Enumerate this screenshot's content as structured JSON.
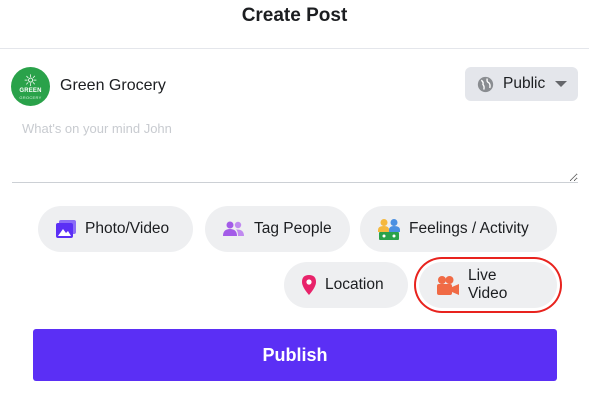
{
  "dialog": {
    "title": "Create Post"
  },
  "page": {
    "name": "Green Grocery",
    "logo_word": "GREEN",
    "logo_sub": "GROCERY",
    "logo_color": "#2aa24a"
  },
  "privacy": {
    "label": "Public",
    "icon": "globe-icon"
  },
  "composer": {
    "placeholder": "What's on your mind John",
    "value": ""
  },
  "actions": {
    "photo_video": {
      "label": "Photo/Video",
      "icon": "photo-icon",
      "color": "#5b2ff5"
    },
    "tag_people": {
      "label": "Tag People",
      "icon": "people-icon",
      "color": "#a35be8"
    },
    "feelings": {
      "label": "Feelings / Activity",
      "icon": "feelings-icon"
    },
    "location": {
      "label": "Location",
      "icon": "location-pin-icon",
      "color": "#e8236a"
    },
    "live_video": {
      "label": "Live Video",
      "icon": "video-camera-icon",
      "color": "#f06a45",
      "highlight_color": "#e8231e"
    }
  },
  "publish": {
    "label": "Publish",
    "color": "#5b2ff5"
  }
}
